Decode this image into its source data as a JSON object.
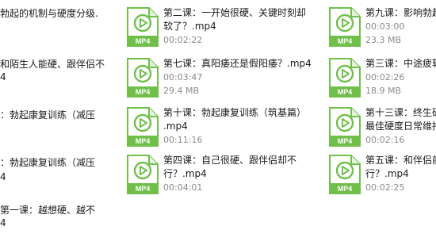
{
  "left_fragments": [
    "勃起的机制与硬度分级.",
    "和陌生人能硬、跟伴侣不",
    "4",
    "：勃起康复训练（减压",
    "：勃起康复训练（减压",
    "4",
    "第一课：越想硬、越不",
    "4"
  ],
  "files": [
    {
      "name_lines": [
        "第二课：一开始很硬、关键时刻却",
        "软了？.mp4"
      ],
      "meta": "00:02:22"
    },
    {
      "name_lines": [
        "第九课：影响勃起"
      ],
      "meta": "00:03:00",
      "meta2": "23.3 MB"
    },
    {
      "name_lines": [
        "第七课：真阳痿还是假阳痿？.mp4"
      ],
      "meta": "00:03:47",
      "meta2": "29.4 MB"
    },
    {
      "name_lines": [
        "第三课：中途疲软"
      ],
      "meta": "00:02:26",
      "meta2": "18.9 MB"
    },
    {
      "name_lines": [
        "第十课：勃起康复训练（筑基篇）",
        ".mp4"
      ],
      "meta": "00:11:16"
    },
    {
      "name_lines": [
        "第十三课：终生硬",
        "最佳硬度日常维持"
      ],
      "meta": "00:02:16"
    },
    {
      "name_lines": [
        "第四课：自己很硬、跟伴侣却不",
        "行？.mp4"
      ],
      "meta": "00:04:01"
    },
    {
      "name_lines": [
        "第五课：和伴侣前",
        "行？.mp4"
      ],
      "meta": "00:02:25"
    }
  ],
  "icon": {
    "label": "MP4",
    "name": "mp4-video-file-icon",
    "color": "#6fbf4a"
  }
}
